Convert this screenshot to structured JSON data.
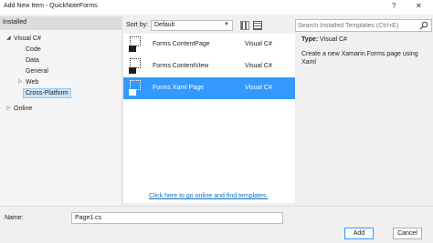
{
  "window": {
    "title": "Add New Item - QuickNoteForms",
    "help_glyph": "?",
    "close_glyph": "✕"
  },
  "sidebar": {
    "header": "Installed",
    "items": [
      {
        "label": "Visual C#",
        "arrow": "◢"
      },
      {
        "label": "Code"
      },
      {
        "label": "Data"
      },
      {
        "label": "General"
      },
      {
        "label": "Web",
        "arrow": "▷"
      },
      {
        "label": "Cross-Platform"
      },
      {
        "label": "Online",
        "arrow": "▷"
      }
    ]
  },
  "sort": {
    "label": "Sort by:",
    "value": "Default"
  },
  "search": {
    "placeholder": "Search Installed Templates (Ctrl+E)"
  },
  "templates": [
    {
      "name": "Forms ContentPage",
      "lang": "Visual C#"
    },
    {
      "name": "Forms ContentView",
      "lang": "Visual C#"
    },
    {
      "name": "Forms Xaml Page",
      "lang": "Visual C#"
    }
  ],
  "online_link": "Click here to go online and find templates.",
  "details": {
    "type_label": "Type:",
    "type_value": "Visual C#",
    "description": "Create a new Xamarin.Forms page using Xaml"
  },
  "footer": {
    "name_label": "Name:",
    "name_value": "Page1.cs",
    "add_label": "Add",
    "cancel_label": "Cancel"
  }
}
